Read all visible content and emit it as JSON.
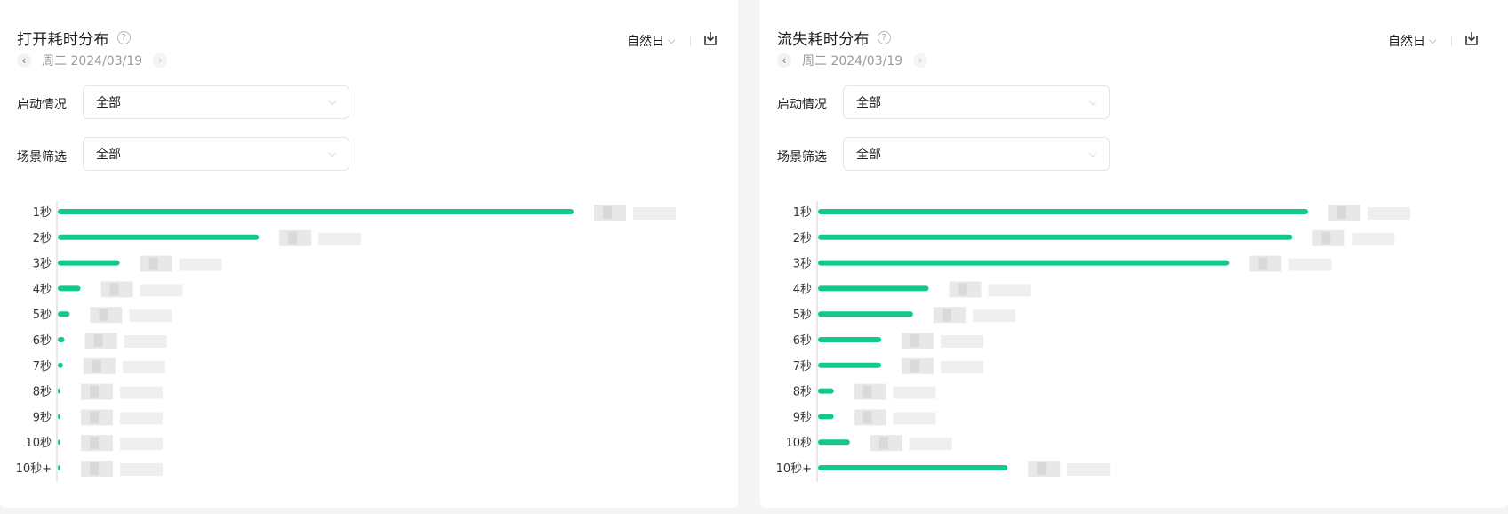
{
  "left_panel": {
    "title": "打开耗时分布",
    "help_icon": "question-circle-icon",
    "date": "周二 2024/03/19",
    "period_select": "自然日",
    "download_icon": "download-icon",
    "filters": [
      {
        "label": "启动情况",
        "value": "全部"
      },
      {
        "label": "场景筛选",
        "value": "全部"
      }
    ]
  },
  "right_panel": {
    "title": "流失耗时分布",
    "help_icon": "question-circle-icon",
    "date": "周二 2024/03/19",
    "period_select": "自然日",
    "download_icon": "download-icon",
    "filters": [
      {
        "label": "启动情况",
        "value": "全部"
      },
      {
        "label": "场景筛选",
        "value": "全部"
      }
    ]
  },
  "colors": {
    "bar": "#10c98a",
    "axis": "#d0d0d0",
    "blur": "#e6e6e6"
  },
  "chart_data": [
    {
      "type": "bar",
      "orientation": "horizontal",
      "categories": [
        "1秒",
        "2秒",
        "3秒",
        "4秒",
        "5秒",
        "6秒",
        "7秒",
        "8秒",
        "9秒",
        "10秒",
        "10秒+"
      ],
      "values": [
        100,
        39,
        12,
        4.4,
        2.3,
        1.3,
        1.0,
        0.5,
        0.4,
        0.3,
        0.3
      ],
      "value_labels": "obscured",
      "xlim": [
        0,
        100
      ]
    },
    {
      "type": "bar",
      "orientation": "horizontal",
      "categories": [
        "1秒",
        "2秒",
        "3秒",
        "4秒",
        "5秒",
        "6秒",
        "7秒",
        "8秒",
        "9秒",
        "10秒",
        "10秒+"
      ],
      "values": [
        100,
        96.8,
        83.9,
        22.6,
        19.4,
        12.9,
        12.9,
        3.2,
        3.2,
        6.5,
        38.7
      ],
      "value_labels": "obscured",
      "xlim": [
        0,
        100
      ]
    }
  ]
}
